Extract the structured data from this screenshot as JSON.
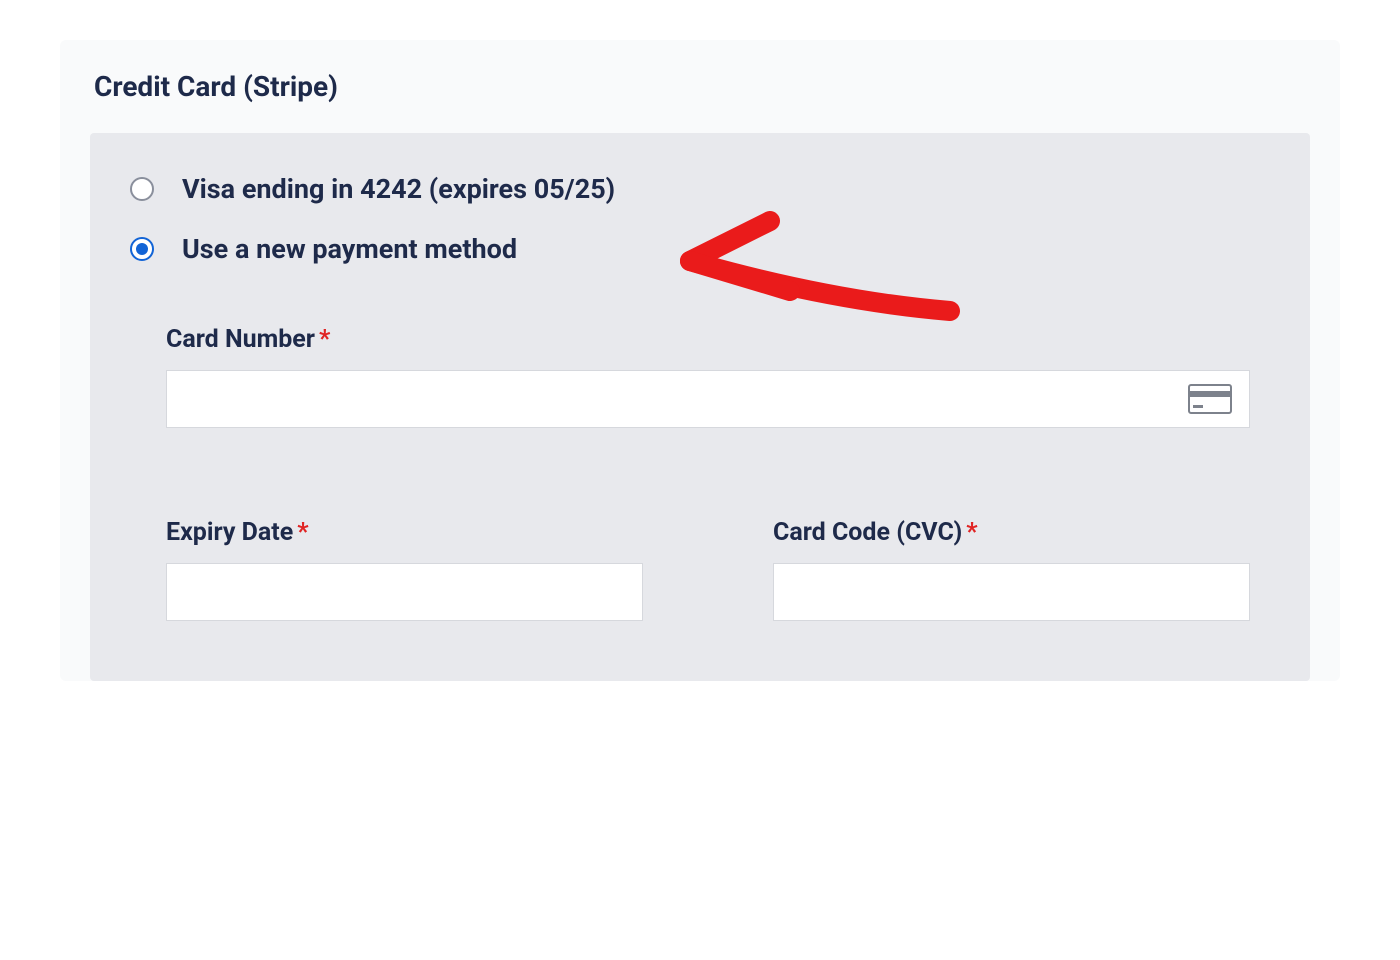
{
  "section": {
    "title": "Credit Card (Stripe)"
  },
  "payment_options": {
    "saved_card_label": "Visa ending in 4242 (expires 05/25)",
    "saved_card_selected": false,
    "new_method_label": "Use a new payment method",
    "new_method_selected": true
  },
  "fields": {
    "card_number": {
      "label": "Card Number",
      "required": "*",
      "value": ""
    },
    "expiry": {
      "label": "Expiry Date",
      "required": "*",
      "value": ""
    },
    "cvc": {
      "label": "Card Code (CVC)",
      "required": "*",
      "value": ""
    }
  },
  "icons": {
    "card": "credit-card-icon"
  },
  "annotation": {
    "arrow_color": "#ea1b1b"
  }
}
